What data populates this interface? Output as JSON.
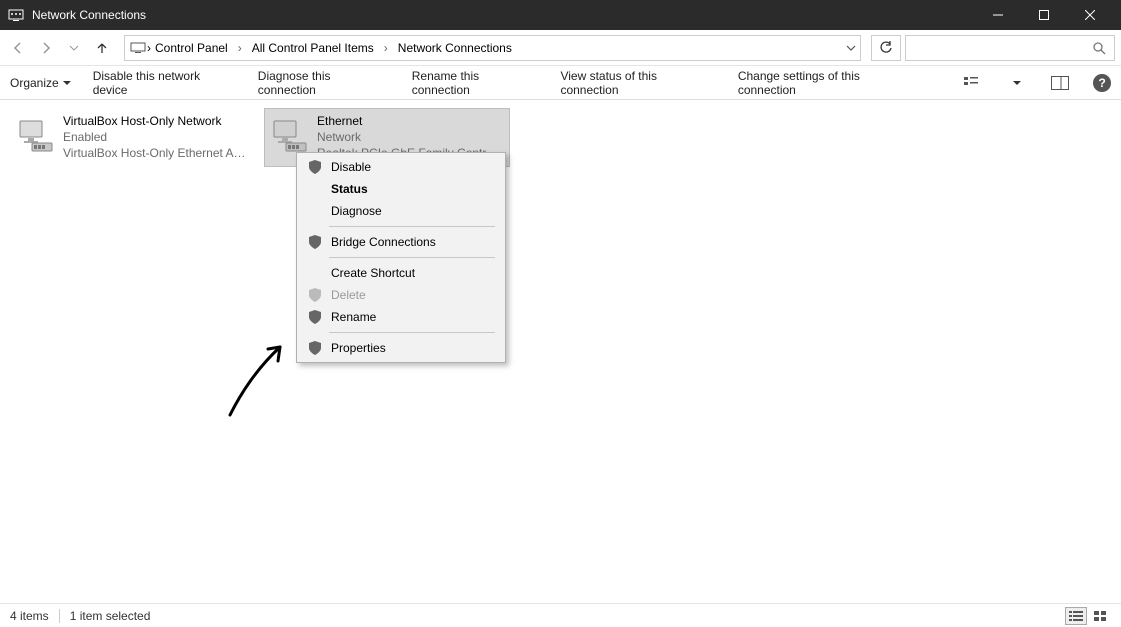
{
  "titlebar": {
    "title": "Network Connections"
  },
  "breadcrumb": {
    "items": [
      "Control Panel",
      "All Control Panel Items",
      "Network Connections"
    ]
  },
  "toolbar": {
    "organize": "Organize",
    "disable": "Disable this network device",
    "diagnose": "Diagnose this connection",
    "rename": "Rename this connection",
    "viewstatus": "View status of this connection",
    "changesettings": "Change settings of this connection"
  },
  "items": [
    {
      "name": "VirtualBox Host-Only Network",
      "status": "Enabled",
      "device": "VirtualBox Host-Only Ethernet Ad..."
    },
    {
      "name": "Ethernet",
      "status": "Network",
      "device": "Realtek PCIe GbE Family Controller"
    }
  ],
  "context_menu": {
    "disable": "Disable",
    "status": "Status",
    "diagnose": "Diagnose",
    "bridge": "Bridge Connections",
    "shortcut": "Create Shortcut",
    "delete": "Delete",
    "rename": "Rename",
    "properties": "Properties"
  },
  "statusbar": {
    "count": "4 items",
    "selected": "1 item selected"
  }
}
